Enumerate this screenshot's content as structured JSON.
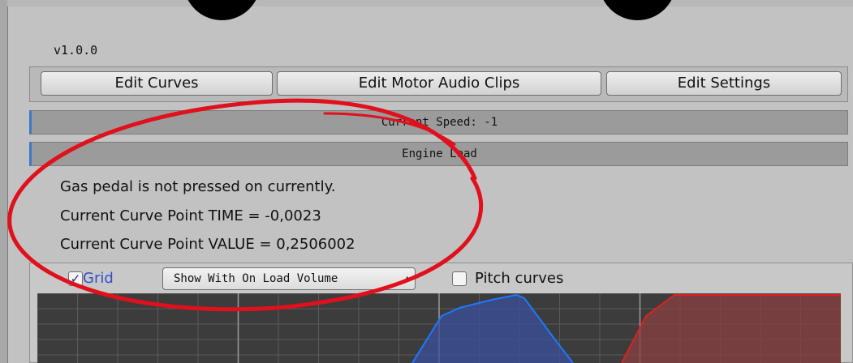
{
  "version": "v1.0.0",
  "tabs": [
    {
      "label": "Edit Curves"
    },
    {
      "label": "Edit Motor Audio Clips"
    },
    {
      "label": "Edit Settings"
    }
  ],
  "current_speed": "Current Speed: -1",
  "engine_load": "Engine Load",
  "info": {
    "gas_pedal": "Gas pedal is not pressed on currently.",
    "curve_time": "Current Curve Point TIME = -0,0023",
    "curve_value": "Current Curve Point VALUE = 0,2506002"
  },
  "curve_panel": {
    "grid": {
      "label": "Grid",
      "checked": true
    },
    "show_mode": "Show With On Load Volume",
    "pitch_curves": {
      "label": "Pitch curves",
      "checked": false
    }
  },
  "colors": {
    "annotation": "#e0101c",
    "blue_curve": "#1e78ff",
    "red_curve": "#e02020",
    "grid_background": "#3c3c3c",
    "accent": "#3b78c9"
  },
  "icons": {
    "grid_checkbox": "checkmark-icon",
    "dropdown_arrow": "up-down-arrow-icon"
  }
}
